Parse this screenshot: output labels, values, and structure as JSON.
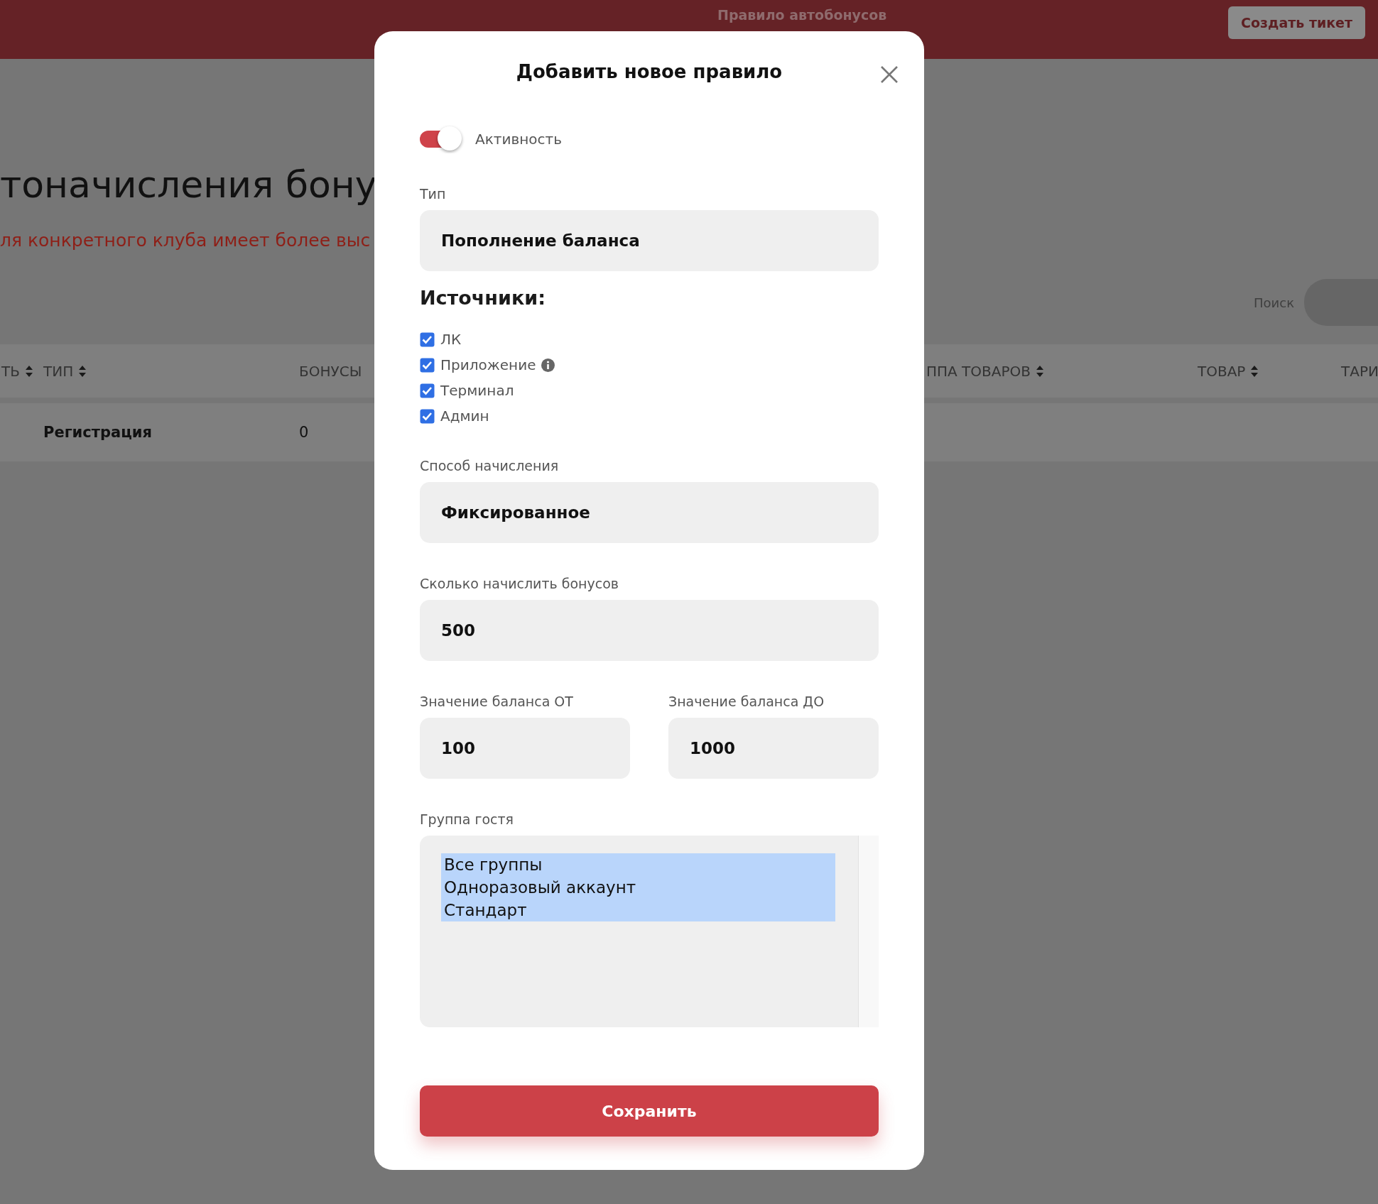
{
  "top_bar": {
    "title": "Правило автобонусов",
    "create_ticket_button": "Создать тикет"
  },
  "page": {
    "title": "тоначисления бону",
    "notice": "ля конкретного клуба имеет более выс",
    "search": {
      "label": "Поиск"
    }
  },
  "table": {
    "columns": [
      {
        "label": "ТЬ",
        "sortable": true
      },
      {
        "label": "ТИП",
        "sortable": true
      },
      {
        "label": "БОНУСЫ",
        "sortable": false
      },
      {
        "label": "ППА ТОВАРОВ",
        "sortable": true
      },
      {
        "label": "ТОВАР",
        "sortable": true
      },
      {
        "label": "ТАРИ",
        "sortable": false
      }
    ],
    "rows": [
      {
        "type": "Регистрация",
        "bonuses": "0"
      }
    ]
  },
  "modal": {
    "title": "Добавить новое правило",
    "active": {
      "label": "Активность",
      "on": true
    },
    "type": {
      "label": "Тип",
      "value": "Пополнение баланса"
    },
    "sources": {
      "heading": "Источники:",
      "items": [
        {
          "label": "ЛК",
          "checked": true,
          "info": false
        },
        {
          "label": "Приложение",
          "checked": true,
          "info": true
        },
        {
          "label": "Терминал",
          "checked": true,
          "info": false
        },
        {
          "label": "Админ",
          "checked": true,
          "info": false
        }
      ]
    },
    "method": {
      "label": "Способ начисления",
      "value": "Фиксированное"
    },
    "amount": {
      "label": "Сколько начислить бонусов",
      "value": "500"
    },
    "balance_from": {
      "label": "Значение баланса ОТ",
      "value": "100"
    },
    "balance_to": {
      "label": "Значение баланса ДО",
      "value": "1000"
    },
    "guest_group": {
      "label": "Группа гостя",
      "options": [
        {
          "label": "Все группы",
          "selected": true
        },
        {
          "label": "Одноразовый аккаунт",
          "selected": true
        },
        {
          "label": "Стандарт",
          "selected": true
        }
      ]
    },
    "save_button": "Сохранить"
  }
}
